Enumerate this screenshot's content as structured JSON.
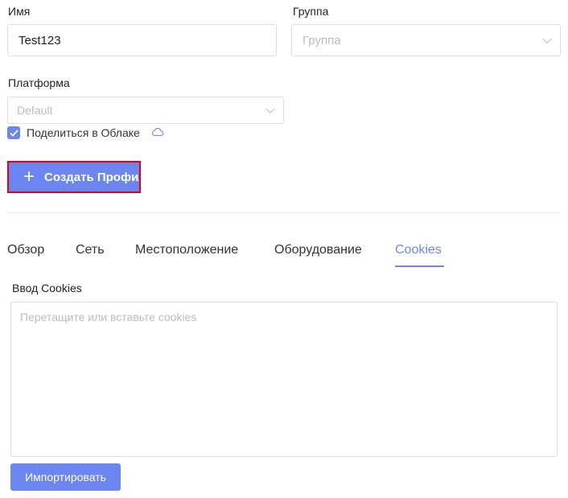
{
  "form": {
    "name_label": "Имя",
    "name_value": "Test123",
    "group_label": "Группа",
    "group_placeholder": "Группа",
    "platform_label": "Платформа",
    "platform_placeholder": "Default",
    "share_checked": true,
    "share_label": "Поделиться в Облаке",
    "share_icon": "cloud-icon"
  },
  "actions": {
    "create_icon": "plus-icon",
    "create_label": "Создать Профиль"
  },
  "tabs": [
    {
      "label": "Обзор",
      "active": false
    },
    {
      "label": "Сеть",
      "active": false
    },
    {
      "label": "Местоположение",
      "active": false
    },
    {
      "label": "Оборудование",
      "active": false
    },
    {
      "label": "Cookies",
      "active": true
    }
  ],
  "cookies": {
    "label": "Ввод Cookies",
    "placeholder": "Перетащите или вставьте cookies",
    "import_label": "Импортировать"
  },
  "colors": {
    "accent": "#6b86f0",
    "highlight_border": "#e00017"
  }
}
